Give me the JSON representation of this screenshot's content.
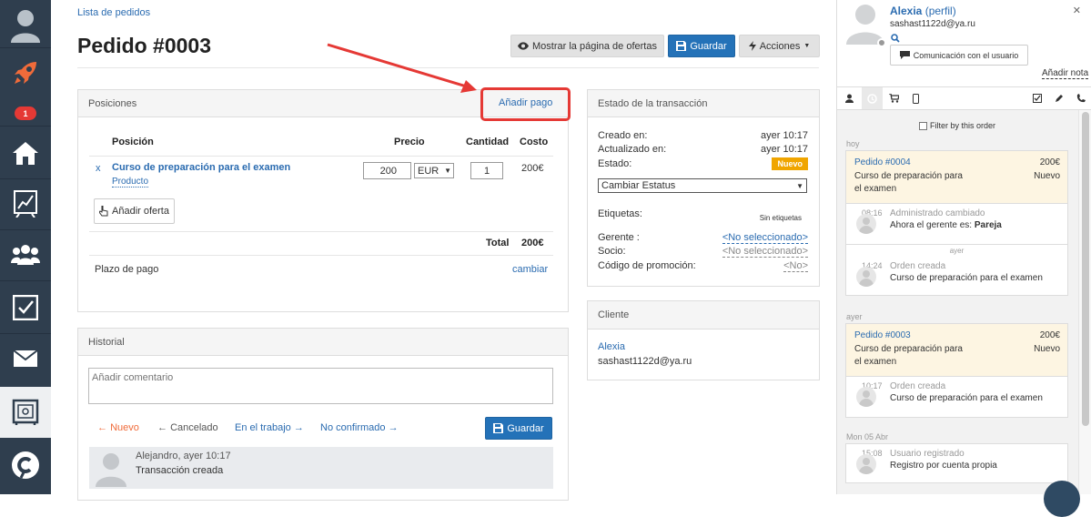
{
  "breadcrumb": "Lista de pedidos",
  "page_title": "Pedido #0003",
  "toolbar": {
    "show_offers": "Mostrar la página de ofertas",
    "save": "Guardar",
    "actions": "Acciones"
  },
  "sidebar": {
    "badge_count": "1",
    "items": [
      "avatar-icon",
      "rocket-icon",
      "home-icon",
      "chart-icon",
      "users-icon",
      "tasks-icon",
      "mail-icon",
      "safe-icon",
      "logo-icon"
    ]
  },
  "positions": {
    "title": "Posiciones",
    "add_payment": "Añadir pago",
    "col_position": "Posición",
    "col_price": "Precio",
    "col_quantity": "Cantidad",
    "col_cost": "Costo",
    "item": {
      "remove": "x",
      "name": "Curso de preparación para el examen",
      "type": "Producto",
      "price": "200",
      "currency": "EUR",
      "quantity": "1",
      "cost": "200€"
    },
    "add_offer": "Añadir oferta",
    "total_label": "Total",
    "total_value": "200€",
    "payment_term_label": "Plazo de pago",
    "payment_term_change": "cambiar"
  },
  "history": {
    "title": "Historial",
    "comment_placeholder": "Añadir comentario",
    "statuses": [
      {
        "label": "Nuevo",
        "prefix": "← ",
        "suffix": ""
      },
      {
        "label": "Cancelado",
        "prefix": "← ",
        "suffix": ""
      },
      {
        "label": "En el trabajo",
        "prefix": "",
        "suffix": " →"
      },
      {
        "label": "No confirmado",
        "prefix": "",
        "suffix": " →"
      }
    ],
    "save": "Guardar",
    "entry": {
      "author": "Alejandro, ayer 10:17",
      "text": "Transacción creada"
    }
  },
  "transaction": {
    "title": "Estado de la transacción",
    "created_label": "Creado en:",
    "created_value": "ayer 10:17",
    "updated_label": "Actualizado en:",
    "updated_value": "ayer 10:17",
    "status_label": "Estado:",
    "status_value": "Nuevo",
    "change_status": "Cambiar Estatus",
    "tags_label": "Etiquetas:",
    "tags_value": "Sin etiquetas",
    "manager_label": "Gerente :",
    "manager_value": "<No seleccionado>",
    "partner_label": "Socio:",
    "partner_value": "<No seleccionado>",
    "promo_label": "Código de promoción:",
    "promo_value": "<No>"
  },
  "client": {
    "title": "Cliente",
    "name": "Alexia",
    "email": "sashast1122d@ya.ru"
  },
  "user_panel": {
    "name": "Alexia",
    "profile_link": "(perfil)",
    "email": "sashast1122d@ya.ru",
    "communication": "Comunicación con el usuario",
    "add_note": "Añadir nota",
    "filter_label": "Filter by this order"
  },
  "timeline": {
    "day_today": "hoy",
    "order1": {
      "title": "Pedido #0004",
      "amount": "200€",
      "desc1": "Curso de preparación para",
      "desc2": "el examen",
      "status": "Nuevo"
    },
    "ev1": {
      "time": "08:16",
      "title": "Administrado cambiado",
      "text_prefix": "Ahora el gerente es: ",
      "text_bold": "Pareja"
    },
    "sep_yesterday": "ayer",
    "ev2": {
      "time": "14:24",
      "title": "Orden creada",
      "text": "Curso de preparación para el examen"
    },
    "day_yesterday": "ayer",
    "order2": {
      "title": "Pedido #0003",
      "amount": "200€",
      "desc1": "Curso de preparación para",
      "desc2": "el examen",
      "status": "Nuevo"
    },
    "ev3": {
      "time": "10:17",
      "title": "Orden creada",
      "text": "Curso de preparación para el examen"
    },
    "day_mon": "Mon 05 Abr",
    "ev4": {
      "time": "15:08",
      "title": "Usuario registrado",
      "text": "Registro por cuenta propia"
    }
  },
  "colors": {
    "sidebar": "#2f3e4e",
    "accent": "#2472b8",
    "highlight": "#e53935",
    "status": "#f0a500"
  }
}
